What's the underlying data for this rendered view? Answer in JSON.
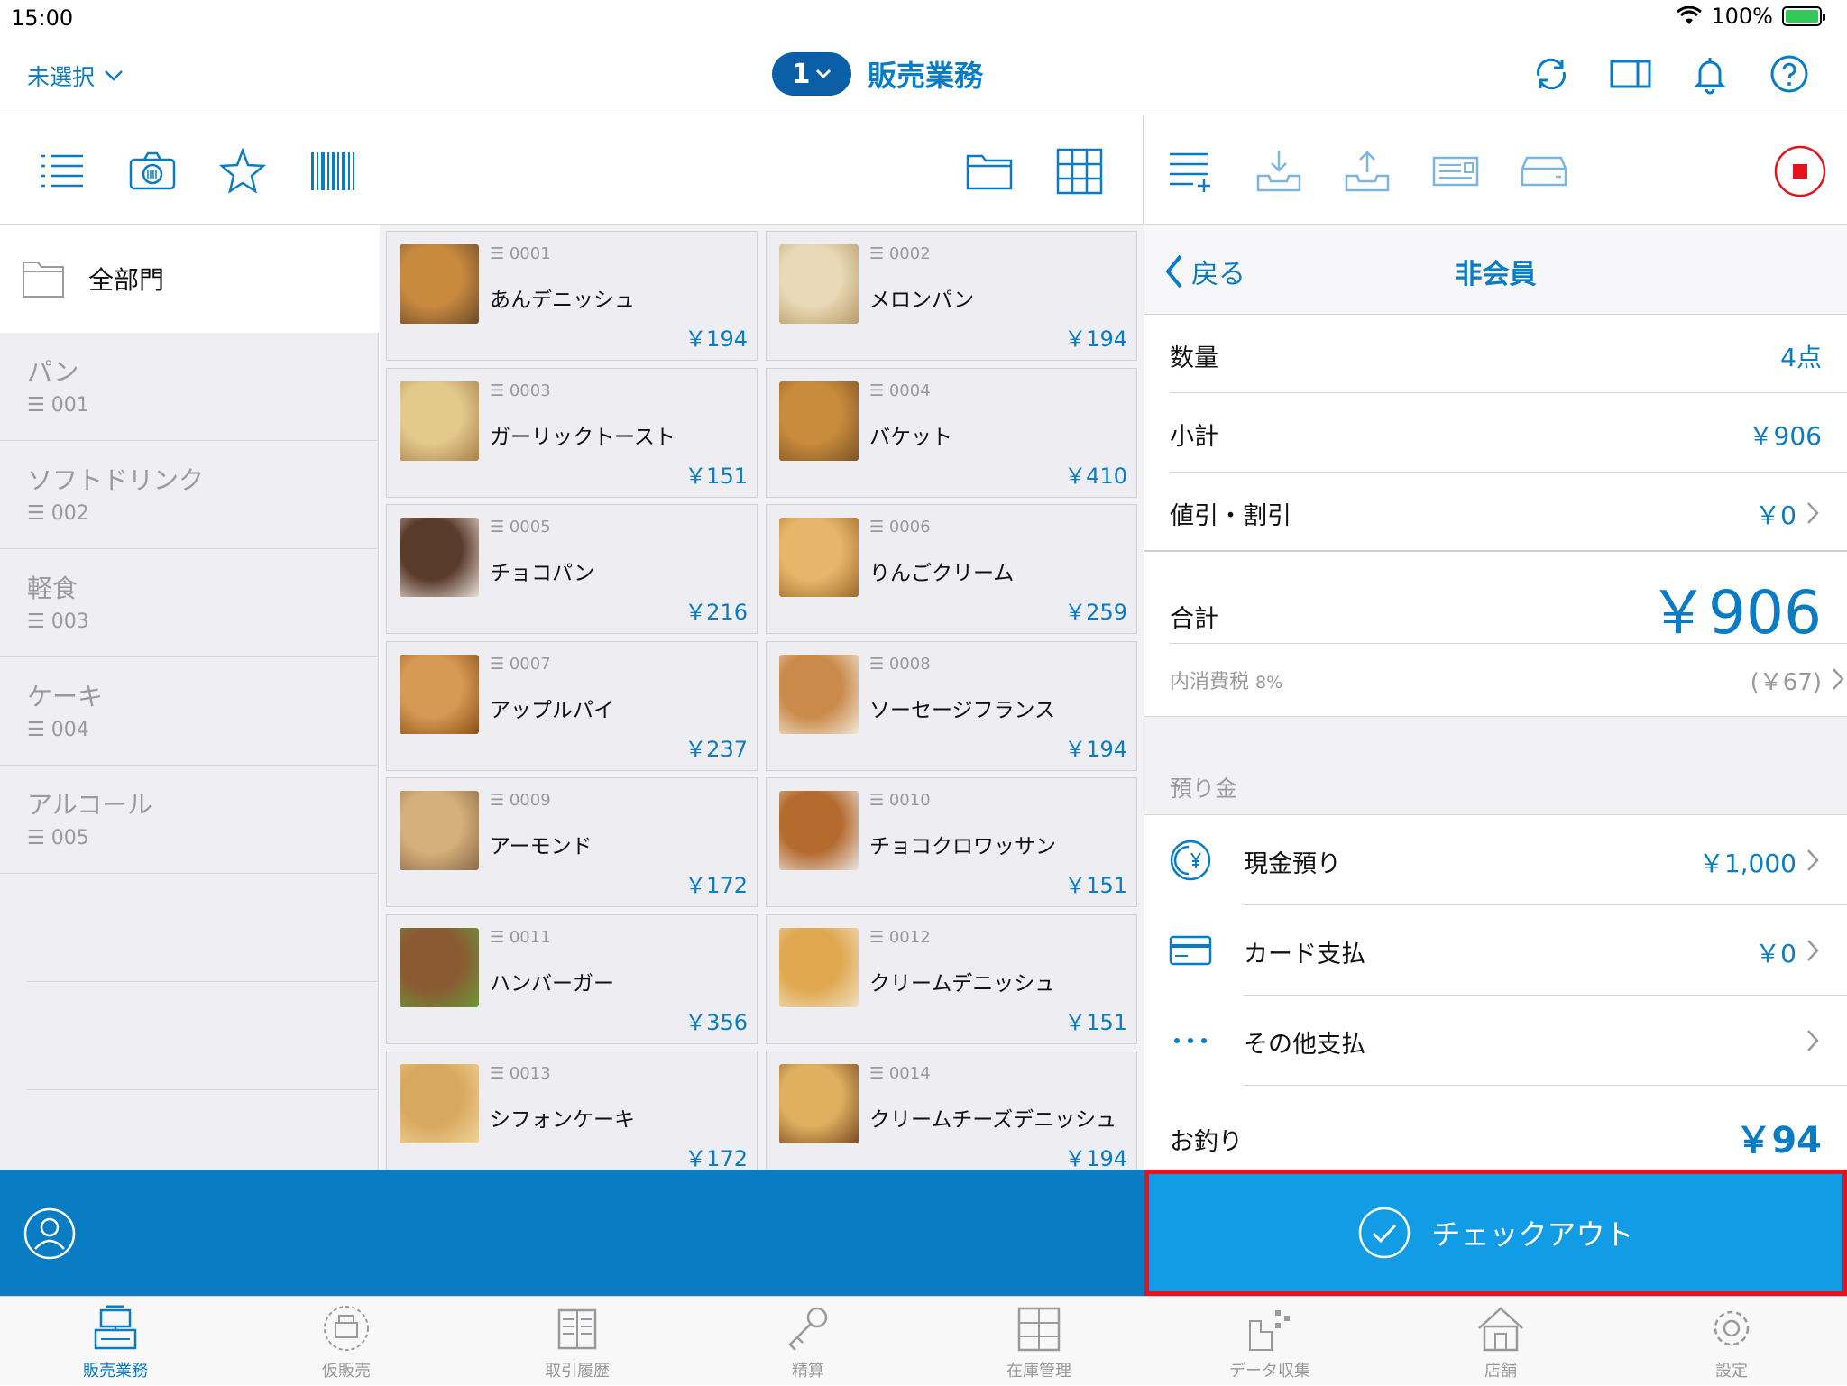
{
  "status_bar": {
    "time": "15:00",
    "battery": "100%"
  },
  "navbar": {
    "store_label": "未選択",
    "register_number": "1",
    "title": "販売業務"
  },
  "categories": {
    "all_label": "全部門",
    "items": [
      {
        "name": "パン",
        "code": "001"
      },
      {
        "name": "ソフトドリンク",
        "code": "002"
      },
      {
        "name": "軽食",
        "code": "003"
      },
      {
        "name": "ケーキ",
        "code": "004"
      },
      {
        "name": "アルコール",
        "code": "005"
      }
    ]
  },
  "products": [
    {
      "code": "0001",
      "name": "あんデニッシュ",
      "price": "￥194"
    },
    {
      "code": "0002",
      "name": "メロンパン",
      "price": "￥194"
    },
    {
      "code": "0003",
      "name": "ガーリックトースト",
      "price": "￥151"
    },
    {
      "code": "0004",
      "name": "バケット",
      "price": "￥410"
    },
    {
      "code": "0005",
      "name": "チョコパン",
      "price": "￥216"
    },
    {
      "code": "0006",
      "name": "りんごクリーム",
      "price": "￥259"
    },
    {
      "code": "0007",
      "name": "アップルパイ",
      "price": "￥237"
    },
    {
      "code": "0008",
      "name": "ソーセージフランス",
      "price": "￥194"
    },
    {
      "code": "0009",
      "name": "アーモンド",
      "price": "￥172"
    },
    {
      "code": "0010",
      "name": "チョコクロワッサン",
      "price": "￥151"
    },
    {
      "code": "0011",
      "name": "ハンバーガー",
      "price": "￥356"
    },
    {
      "code": "0012",
      "name": "クリームデニッシュ",
      "price": "￥151"
    },
    {
      "code": "0013",
      "name": "シフォンケーキ",
      "price": "￥172"
    },
    {
      "code": "0014",
      "name": "クリームチーズデニッシュ",
      "price": "￥194"
    }
  ],
  "cart": {
    "back_label": "戻る",
    "member_label": "非会員",
    "quantity_label": "数量",
    "quantity_value": "4点",
    "subtotal_label": "小計",
    "subtotal_value": "￥906",
    "discount_label": "値引・割引",
    "discount_value": "￥0",
    "total_label": "合計",
    "total_value": "￥906",
    "tax_label": "内消費税",
    "tax_rate": "8%",
    "tax_value": "(￥67)",
    "deposit_header": "預り金",
    "cash_label": "現金預り",
    "cash_value": "￥1,000",
    "card_label": "カード支払",
    "card_value": "￥0",
    "other_label": "その他支払",
    "change_label": "お釣り",
    "change_value": "￥94"
  },
  "checkout_label": "チェックアウト",
  "tabs": [
    {
      "label": "販売業務",
      "icon": "register-icon"
    },
    {
      "label": "仮販売",
      "icon": "temp-sale-icon"
    },
    {
      "label": "取引履歴",
      "icon": "history-icon"
    },
    {
      "label": "精算",
      "icon": "key-icon"
    },
    {
      "label": "在庫管理",
      "icon": "inventory-icon"
    },
    {
      "label": "データ収集",
      "icon": "data-collect-icon"
    },
    {
      "label": "店舗",
      "icon": "store-icon"
    },
    {
      "label": "設定",
      "icon": "settings-icon"
    }
  ],
  "colors": {
    "accent": "#0a7cc4",
    "checkout": "#139ce6",
    "highlight": "#e3141c"
  }
}
